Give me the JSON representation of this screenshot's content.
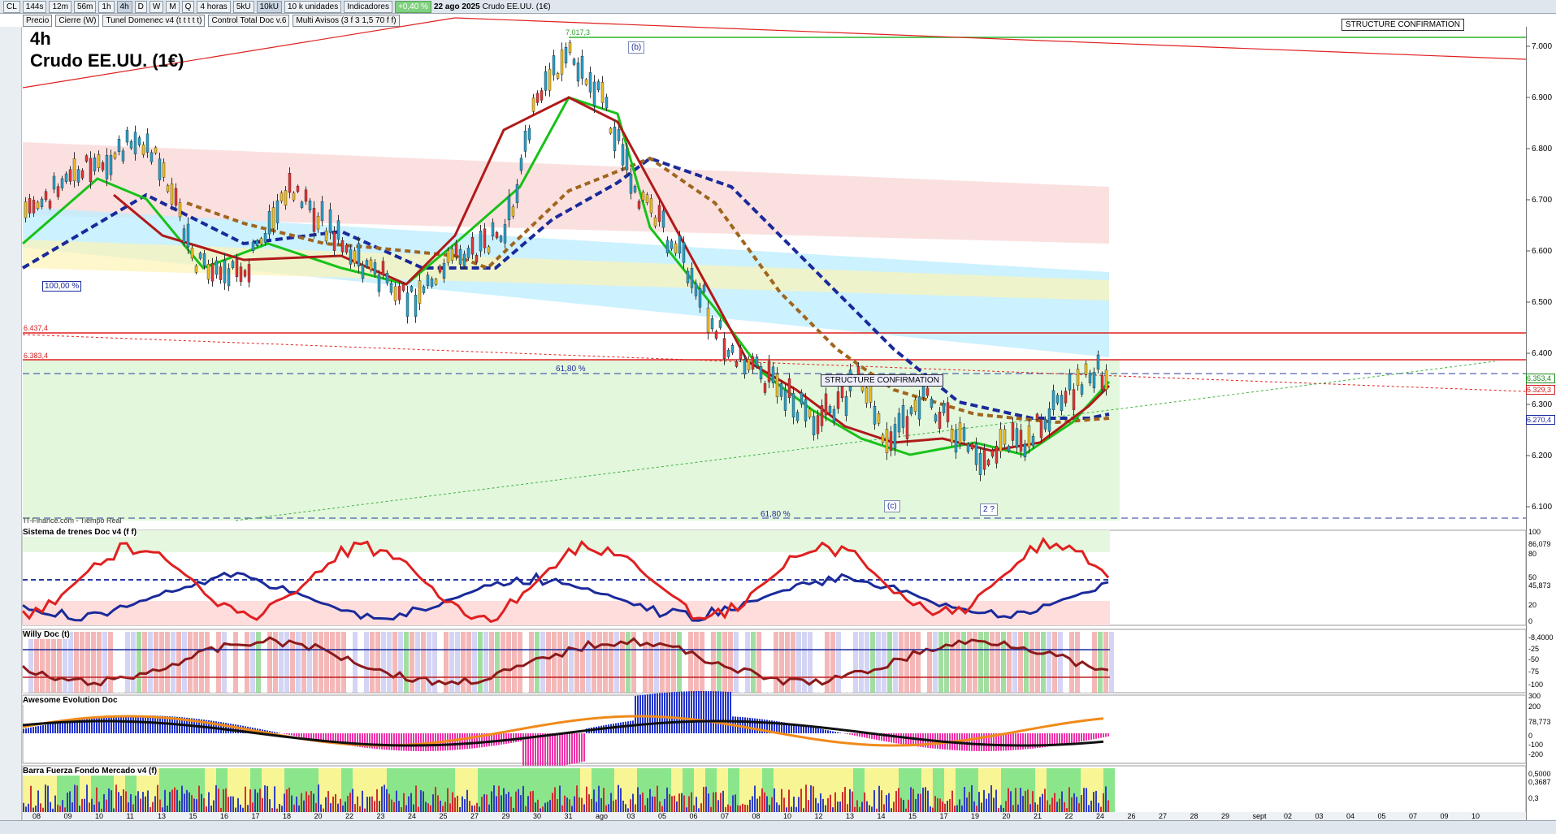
{
  "toolbar": {
    "symbol": "CL",
    "intervals": [
      "144s",
      "12m",
      "56m",
      "1h",
      "4h",
      "D",
      "W",
      "M",
      "Q"
    ],
    "interval_selected": "4h",
    "period_label": "4 horas",
    "size_buttons": [
      "5kU",
      "10kU"
    ],
    "units_label": "10 k unidades",
    "indicators_label": "Indicadores",
    "change_badge": "+0,40 %",
    "date": "22 ago 2025",
    "instrument": "Crudo EE.UU. (1€)"
  },
  "chips": [
    "Precio",
    "Cierre (W)",
    "Tunel Domenec v4 (t t t t t)",
    "Control Total Doc v.6",
    "Multi Avisos (3 f 3 1,5 70 f f)"
  ],
  "chart": {
    "timeframe": "4h",
    "title": "Crudo EE.UU. (1€)",
    "watermark": "IT-Finance.com - Tiempo Real",
    "high_label": "7.017,3",
    "level_1": "6.437,4",
    "level_2": "6.383,4",
    "pct_100": "100,00 %",
    "fib_1": "61,80 %",
    "fib_2": "61,80 %",
    "wave_b": "(b)",
    "wave_c": "(c)",
    "wave_q": "2 ?",
    "structure_box_1": "STRUCTURE CONFIRMATION",
    "structure_box_2": "STRUCTURE CONFIRMATION",
    "price_axis": [
      "7.000",
      "6.900",
      "6.800",
      "6.700",
      "6.600",
      "6.500",
      "6.400",
      "6.300",
      "6.200",
      "6.100"
    ],
    "price_tags": [
      "6.353,4",
      "6.329,3",
      "6.270,4"
    ]
  },
  "panels": {
    "p1": {
      "title": "Sistema de trenes Doc v4 (f f)",
      "axis": [
        "100",
        "86,079",
        "80",
        "50",
        "45,873",
        "20",
        "0"
      ]
    },
    "p2": {
      "title": "Willy Doc (t)",
      "axis": [
        "-8,4000",
        "-25",
        "-50",
        "-75",
        "-100"
      ]
    },
    "p3": {
      "title": "Awesome Evolution Doc",
      "axis": [
        "300",
        "200",
        "78,773",
        "0",
        "-100",
        "-200"
      ]
    },
    "p4": {
      "title": "Barra Fuerza Fondo Mercado v4 (f)",
      "axis": [
        "0,5000",
        "0,3687",
        "0,3"
      ]
    }
  },
  "time_axis": [
    "08",
    "09",
    "10",
    "11",
    "13",
    "15",
    "16",
    "17",
    "18",
    "20",
    "22",
    "23",
    "24",
    "25",
    "27",
    "29",
    "30",
    "31",
    "ago",
    "03",
    "05",
    "06",
    "07",
    "08",
    "10",
    "12",
    "13",
    "14",
    "15",
    "17",
    "19",
    "20",
    "21",
    "22",
    "24",
    "26",
    "27",
    "28",
    "29",
    "sept",
    "02",
    "03",
    "04",
    "05",
    "07",
    "09",
    "10"
  ],
  "colors": {
    "up": "#2aa0c8",
    "down": "#e63333",
    "green": "#19c519",
    "brown": "#a0661e",
    "navy": "#1a2a9a"
  }
}
